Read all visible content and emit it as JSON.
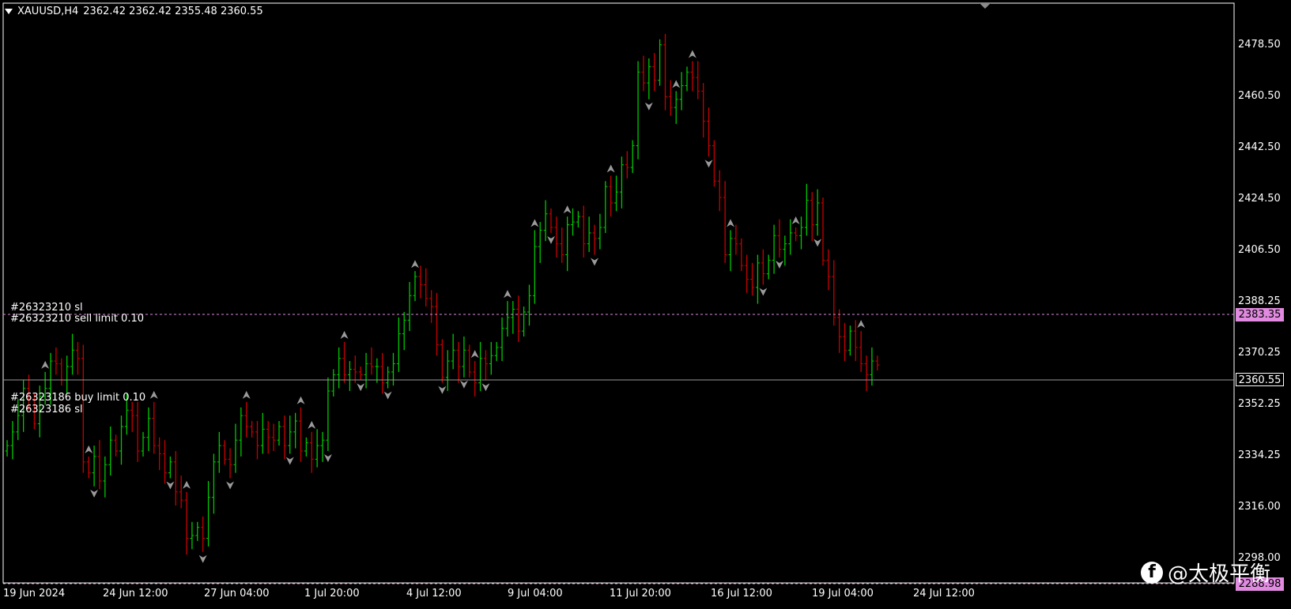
{
  "header": {
    "symbol": "XAUUSD,H4",
    "ohlc": "2362.42 2362.42 2355.48 2360.55",
    "menu_icon": "triangle-down-icon"
  },
  "orders": {
    "sell_sl_label": "#26323210 sl",
    "sell_limit_label": "#26323210 sell limit 0.10",
    "buy_limit_label": "#26323186 buy limit 0.10",
    "buy_sl_label": "#26323186 sl"
  },
  "price_tags": {
    "sell_limit": "2383.35",
    "current": "2360.55",
    "buy_limit": "2288.98"
  },
  "colors": {
    "background": "#000000",
    "bull": "#00c800",
    "bear": "#c80000",
    "order_line": "#d98cd9",
    "current_line": "#9a9a9a",
    "fractal": "#9a9a9a"
  },
  "price_axis": [
    "2478.50",
    "2460.50",
    "2442.50",
    "2424.50",
    "2406.50",
    "2388.25",
    "2370.25",
    "2352.25",
    "2334.25",
    "2316.00",
    "2298.00"
  ],
  "time_axis": [
    "19 Jun 2024",
    "24 Jun 12:00",
    "27 Jun 04:00",
    "1 Jul 20:00",
    "4 Jul 12:00",
    "9 Jul 04:00",
    "11 Jul 20:00",
    "16 Jul 12:00",
    "19 Jul 04:00",
    "24 Jul 12:00"
  ],
  "watermark": {
    "text": "@太极平衡",
    "icon": "facebook-icon",
    "icon_text": "f"
  },
  "chart_data": {
    "type": "ohlc",
    "symbol": "XAUUSD",
    "timeframe": "H4",
    "ylim": [
      2288.98,
      2490
    ],
    "order_levels": {
      "sell_limit": 2383.35,
      "buy_limit": 2288.98,
      "current": 2360.55
    },
    "closes": [
      2331,
      2336,
      2342,
      2352,
      2348,
      2339,
      2349,
      2352,
      2362,
      2361,
      2355,
      2360,
      2366,
      2363,
      2325,
      2321,
      2327,
      2318,
      2324,
      2333,
      2329,
      2338,
      2344,
      2342,
      2329,
      2334,
      2341,
      2331,
      2328,
      2321,
      2325,
      2314,
      2311,
      2297,
      2298,
      2301,
      2297,
      2312,
      2325,
      2331,
      2326,
      2324,
      2333,
      2342,
      2338,
      2336,
      2331,
      2337,
      2334,
      2333,
      2338,
      2331,
      2336,
      2340,
      2329,
      2332,
      2326,
      2331,
      2333,
      2351,
      2357,
      2363,
      2357,
      2359,
      2358,
      2357,
      2361,
      2360,
      2360,
      2354,
      2358,
      2361,
      2372,
      2377,
      2386,
      2393,
      2390,
      2385,
      2382,
      2368,
      2356,
      2362,
      2366,
      2360,
      2366,
      2358,
      2354,
      2363,
      2361,
      2364,
      2367,
      2374,
      2378,
      2381,
      2373,
      2380,
      2386,
      2404,
      2410,
      2416,
      2411,
      2405,
      2401,
      2412,
      2413,
      2415,
      2405,
      2409,
      2407,
      2411,
      2426,
      2420,
      2424,
      2434,
      2433,
      2441,
      2468,
      2464,
      2470,
      2465,
      2478,
      2459,
      2455,
      2458,
      2463,
      2468,
      2466,
      2461,
      2450,
      2441,
      2428,
      2422,
      2401,
      2407,
      2405,
      2397,
      2392,
      2389,
      2398,
      2394,
      2399,
      2408,
      2403,
      2405,
      2409,
      2408,
      2411,
      2421,
      2412,
      2420,
      2399,
      2393,
      2378,
      2371,
      2366,
      2373,
      2367,
      2361,
      2357,
      2362,
      2360.55
    ],
    "fractals_up_idx": [
      7,
      15,
      27,
      33,
      44,
      54,
      56,
      62,
      75,
      86,
      92,
      97,
      103,
      111,
      123,
      126,
      133,
      145,
      157,
      165
    ],
    "fractals_down_idx": [
      16,
      30,
      36,
      41,
      52,
      59,
      65,
      70,
      80,
      84,
      88,
      100,
      108,
      118,
      129,
      139,
      142,
      149,
      163,
      168
    ]
  }
}
